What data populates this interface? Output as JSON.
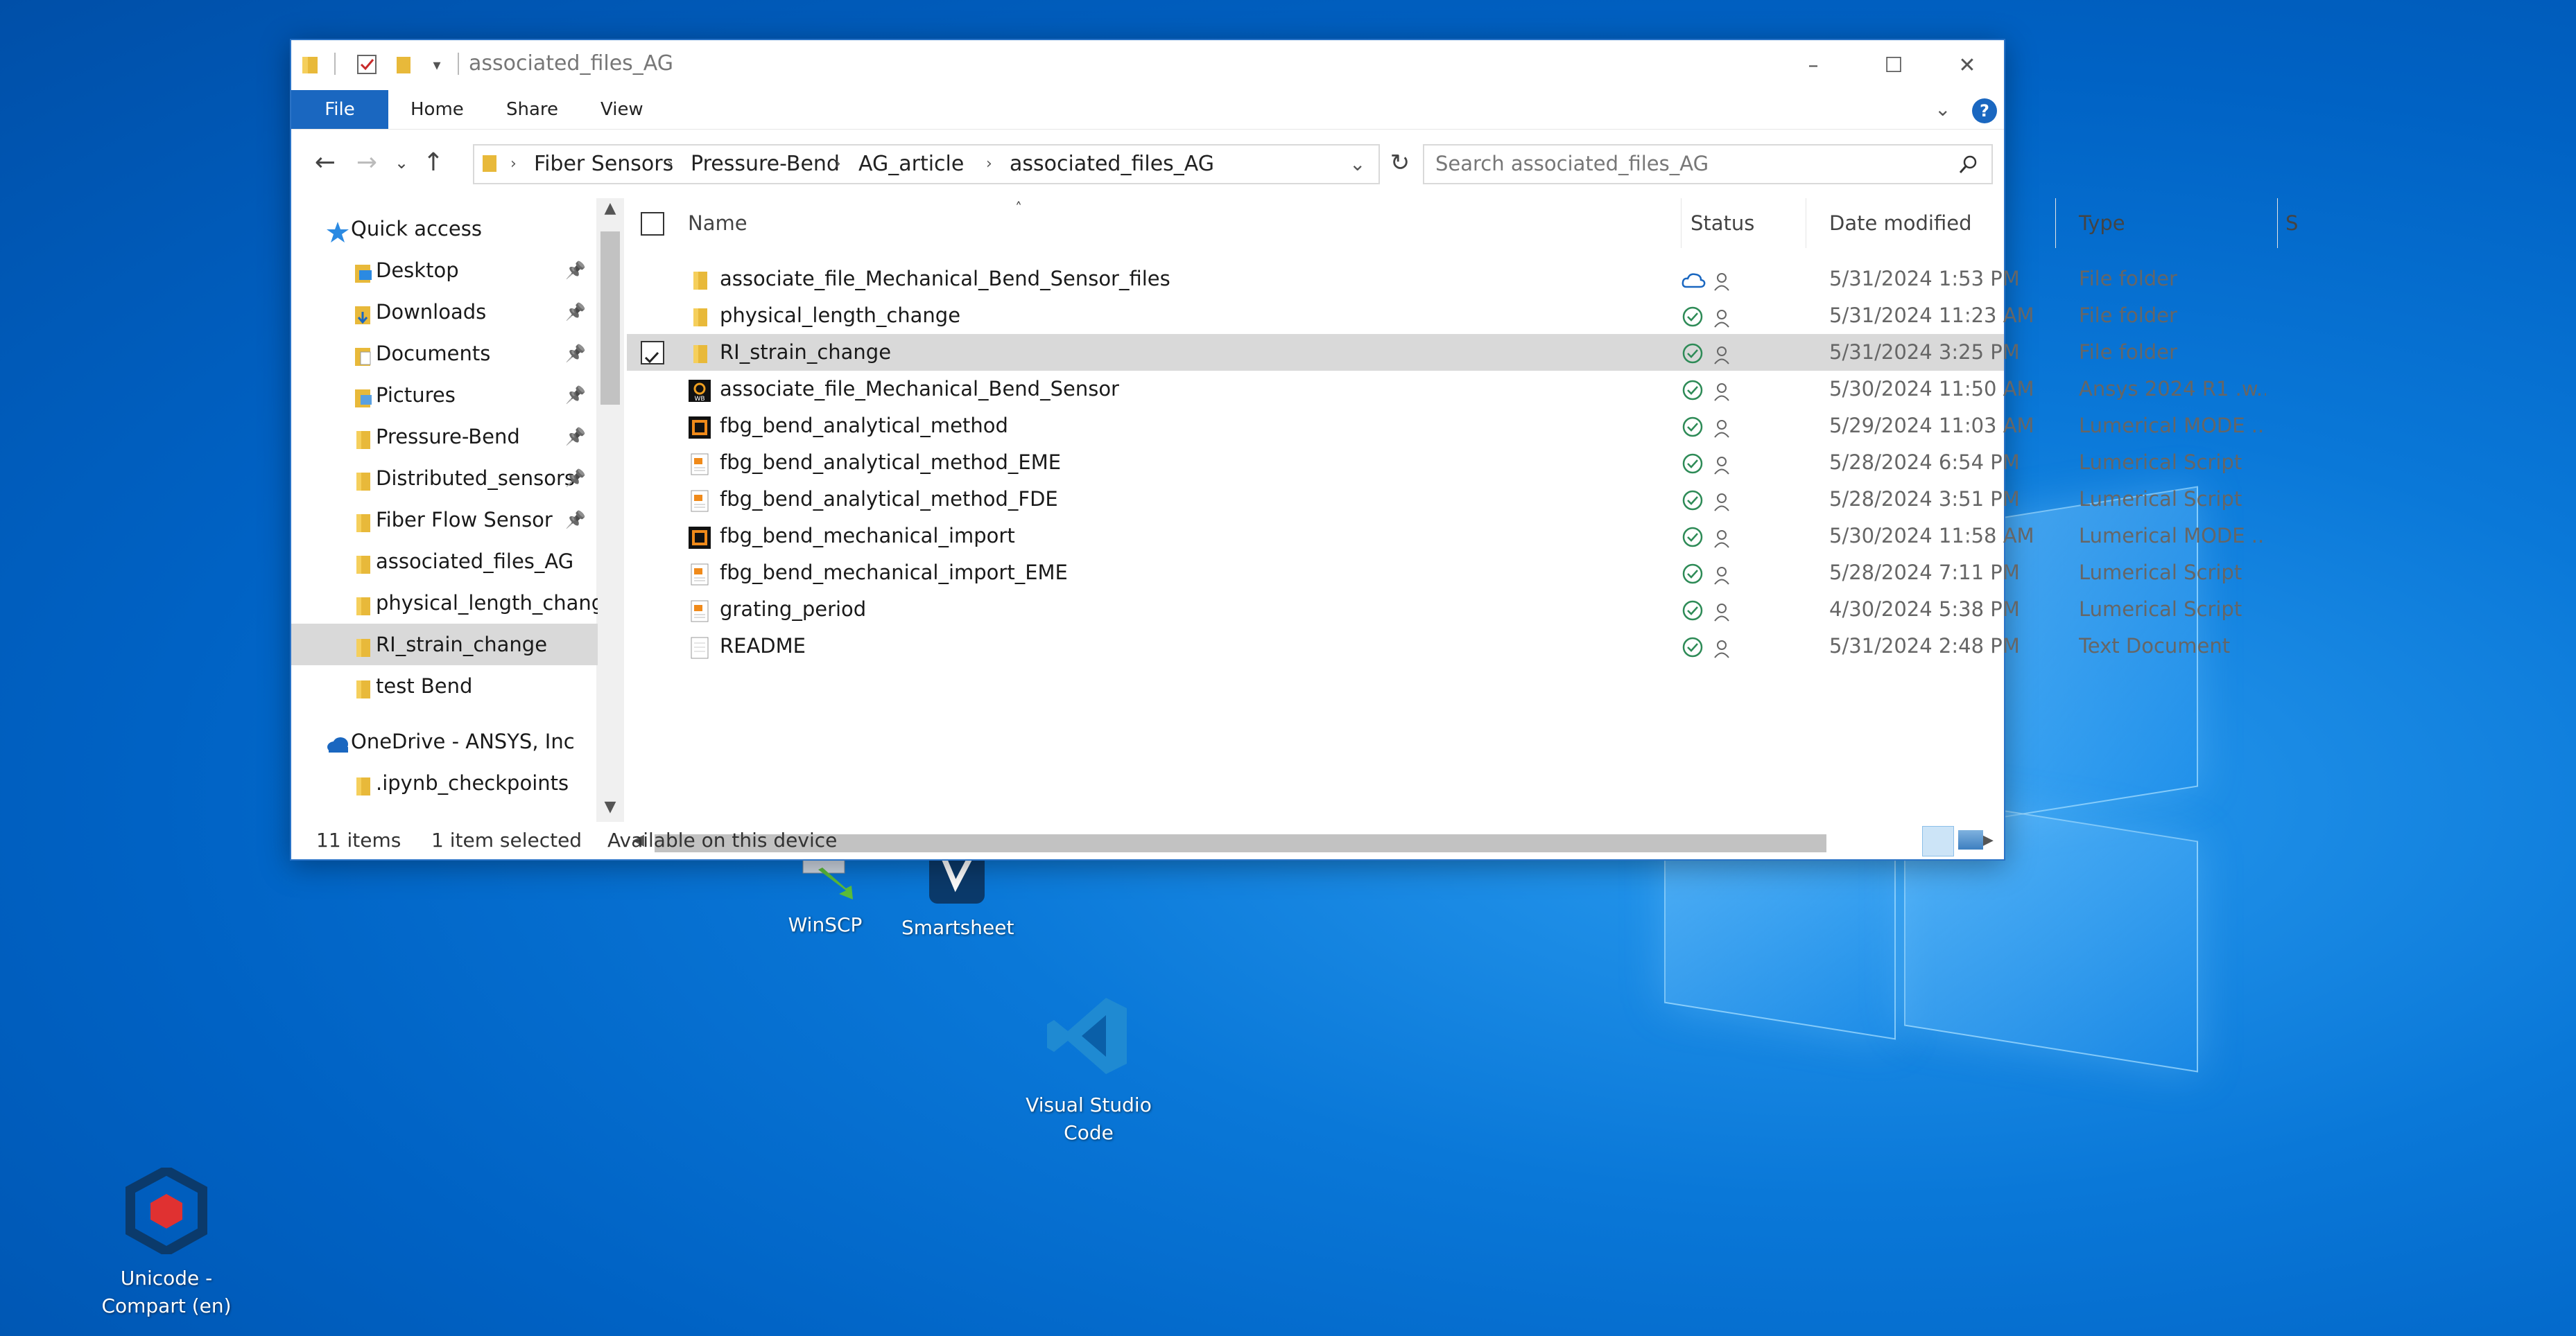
{
  "window": {
    "title": "associated_files_AG"
  },
  "ribbon": {
    "tabs": [
      "File",
      "Home",
      "Share",
      "View"
    ]
  },
  "address": {
    "crumbs": [
      "Fiber Sensors",
      "Pressure-Bend",
      "AG_article",
      "associated_files_AG"
    ]
  },
  "search": {
    "placeholder": "Search associated_files_AG"
  },
  "nav": {
    "items": [
      {
        "label": "Quick access",
        "icon": "star-icon",
        "pinned": false
      },
      {
        "label": "Desktop",
        "icon": "desktop-folder-icon",
        "pinned": true
      },
      {
        "label": "Downloads",
        "icon": "downloads-folder-icon",
        "pinned": true
      },
      {
        "label": "Documents",
        "icon": "documents-folder-icon",
        "pinned": true
      },
      {
        "label": "Pictures",
        "icon": "pictures-folder-icon",
        "pinned": true
      },
      {
        "label": "Pressure-Bend",
        "icon": "folder-icon",
        "pinned": true
      },
      {
        "label": "Distributed_sensors",
        "icon": "folder-icon",
        "pinned": true
      },
      {
        "label": "Fiber Flow Sensor",
        "icon": "folder-icon",
        "pinned": true
      },
      {
        "label": "associated_files_AG",
        "icon": "folder-icon",
        "pinned": false
      },
      {
        "label": "physical_length_change",
        "icon": "folder-icon",
        "pinned": false
      },
      {
        "label": "RI_strain_change",
        "icon": "folder-icon",
        "pinned": false,
        "selected": true
      },
      {
        "label": "test Bend",
        "icon": "folder-icon",
        "pinned": false
      },
      {
        "label": "OneDrive - ANSYS, Inc",
        "icon": "onedrive-cloud-icon",
        "pinned": false
      },
      {
        "label": ".ipynb_checkpoints",
        "icon": "folder-icon",
        "pinned": false
      }
    ]
  },
  "list": {
    "columns": [
      "Name",
      "Status",
      "Date modified",
      "Type",
      "S"
    ],
    "rows": [
      {
        "name": "associate_file_Mechanical_Bend_Sensor_files",
        "status": "cloud",
        "date": "5/31/2024 1:53 PM",
        "type": "File folder",
        "icon": "folder-icon"
      },
      {
        "name": "physical_length_change",
        "status": "synced",
        "date": "5/31/2024 11:23 AM",
        "type": "File folder",
        "icon": "folder-icon"
      },
      {
        "name": "RI_strain_change",
        "status": "synced",
        "date": "5/31/2024 3:25 PM",
        "type": "File folder",
        "icon": "folder-icon",
        "selected": true
      },
      {
        "name": "associate_file_Mechanical_Bend_Sensor",
        "status": "synced",
        "date": "5/30/2024 11:50 AM",
        "type": "Ansys 2024 R1 .w...",
        "icon": "workbench-icon"
      },
      {
        "name": "fbg_bend_analytical_method",
        "status": "synced",
        "date": "5/29/2024 11:03 AM",
        "type": "Lumerical MODE ...",
        "icon": "lumerical-mode-icon"
      },
      {
        "name": "fbg_bend_analytical_method_EME",
        "status": "synced",
        "date": "5/28/2024 6:54 PM",
        "type": "Lumerical Script",
        "icon": "lumerical-script-icon"
      },
      {
        "name": "fbg_bend_analytical_method_FDE",
        "status": "synced",
        "date": "5/28/2024 3:51 PM",
        "type": "Lumerical Script",
        "icon": "lumerical-script-icon"
      },
      {
        "name": "fbg_bend_mechanical_import",
        "status": "synced",
        "date": "5/30/2024 11:58 AM",
        "type": "Lumerical MODE ...",
        "icon": "lumerical-mode-icon"
      },
      {
        "name": "fbg_bend_mechanical_import_EME",
        "status": "synced",
        "date": "5/28/2024 7:11 PM",
        "type": "Lumerical Script",
        "icon": "lumerical-script-icon"
      },
      {
        "name": "grating_period",
        "status": "synced",
        "date": "4/30/2024 5:38 PM",
        "type": "Lumerical Script",
        "icon": "lumerical-script-icon"
      },
      {
        "name": "README",
        "status": "synced",
        "date": "5/31/2024 2:48 PM",
        "type": "Text Document",
        "icon": "text-document-icon"
      }
    ]
  },
  "statusbar": {
    "count": "11 items",
    "selected": "1 item selected",
    "availability": "Available on this device"
  },
  "desktop": {
    "icons": [
      {
        "label": "WinSCP"
      },
      {
        "label": "Smartsheet"
      },
      {
        "label": "Visual Studio Code"
      },
      {
        "label": "Unicode - Compart (en)"
      }
    ]
  },
  "colors": {
    "accent": "#1a67c0",
    "selection": "#d9d9d9",
    "sync_green": "#2e8b57",
    "folder": "#e8b93a"
  }
}
